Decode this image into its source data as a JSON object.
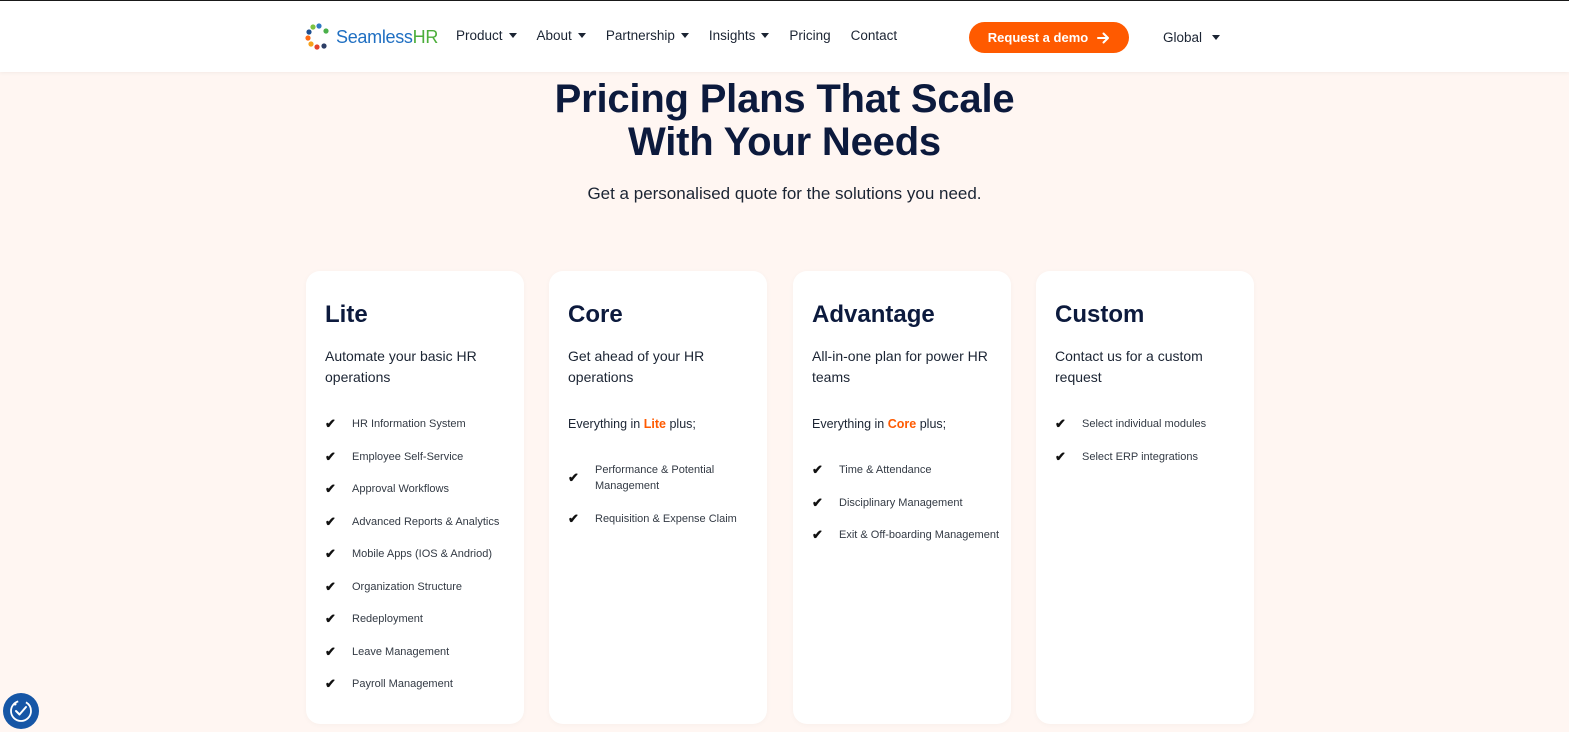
{
  "brand": {
    "name_part1": "Seamless",
    "name_part2": "HR"
  },
  "nav": {
    "items": [
      {
        "label": "Product",
        "dropdown": true
      },
      {
        "label": "About",
        "dropdown": true
      },
      {
        "label": "Partnership",
        "dropdown": true
      },
      {
        "label": "Insights",
        "dropdown": true
      },
      {
        "label": "Pricing",
        "dropdown": false
      },
      {
        "label": "Contact",
        "dropdown": false
      }
    ],
    "cta": "Request a demo",
    "region": "Global"
  },
  "hero": {
    "title_line1": "Pricing Plans That Scale",
    "title_line2": "With Your Needs",
    "subtitle": "Get a personalised quote for the solutions you need."
  },
  "plans": [
    {
      "name": "Lite",
      "desc": "Automate your basic HR operations",
      "features": [
        "HR Information System",
        "Employee Self-Service",
        "Approval Workflows",
        "Advanced Reports & Analytics",
        "Mobile Apps (IOS & Andriod)",
        "Organization Structure",
        "Redeployment",
        "Leave Management",
        "Payroll Management"
      ]
    },
    {
      "name": "Core",
      "desc": "Get ahead of your HR operations",
      "everything_prefix": "Everything in",
      "everything_highlight": "Lite",
      "everything_suffix": "plus;",
      "features": [
        "Performance & Potential Management",
        "Requisition & Expense Claim"
      ]
    },
    {
      "name": "Advantage",
      "desc": "All-in-one plan for power HR teams",
      "everything_prefix": "Everything in",
      "everything_highlight": "Core",
      "everything_suffix": "plus;",
      "features": [
        "Time & Attendance",
        "Disciplinary Management",
        "Exit & Off-boarding Management"
      ]
    },
    {
      "name": "Custom",
      "desc": "Contact us for a custom request",
      "features": [
        "Select individual modules",
        "Select ERP integrations"
      ]
    }
  ],
  "colors": {
    "accent": "#ff5a00",
    "heading": "#0c1a3d",
    "background": "#fff6f2"
  },
  "icons": {
    "check": "check-icon",
    "cta_arrow": "arrow-right-icon",
    "accessibility": "accessibility-icon"
  }
}
